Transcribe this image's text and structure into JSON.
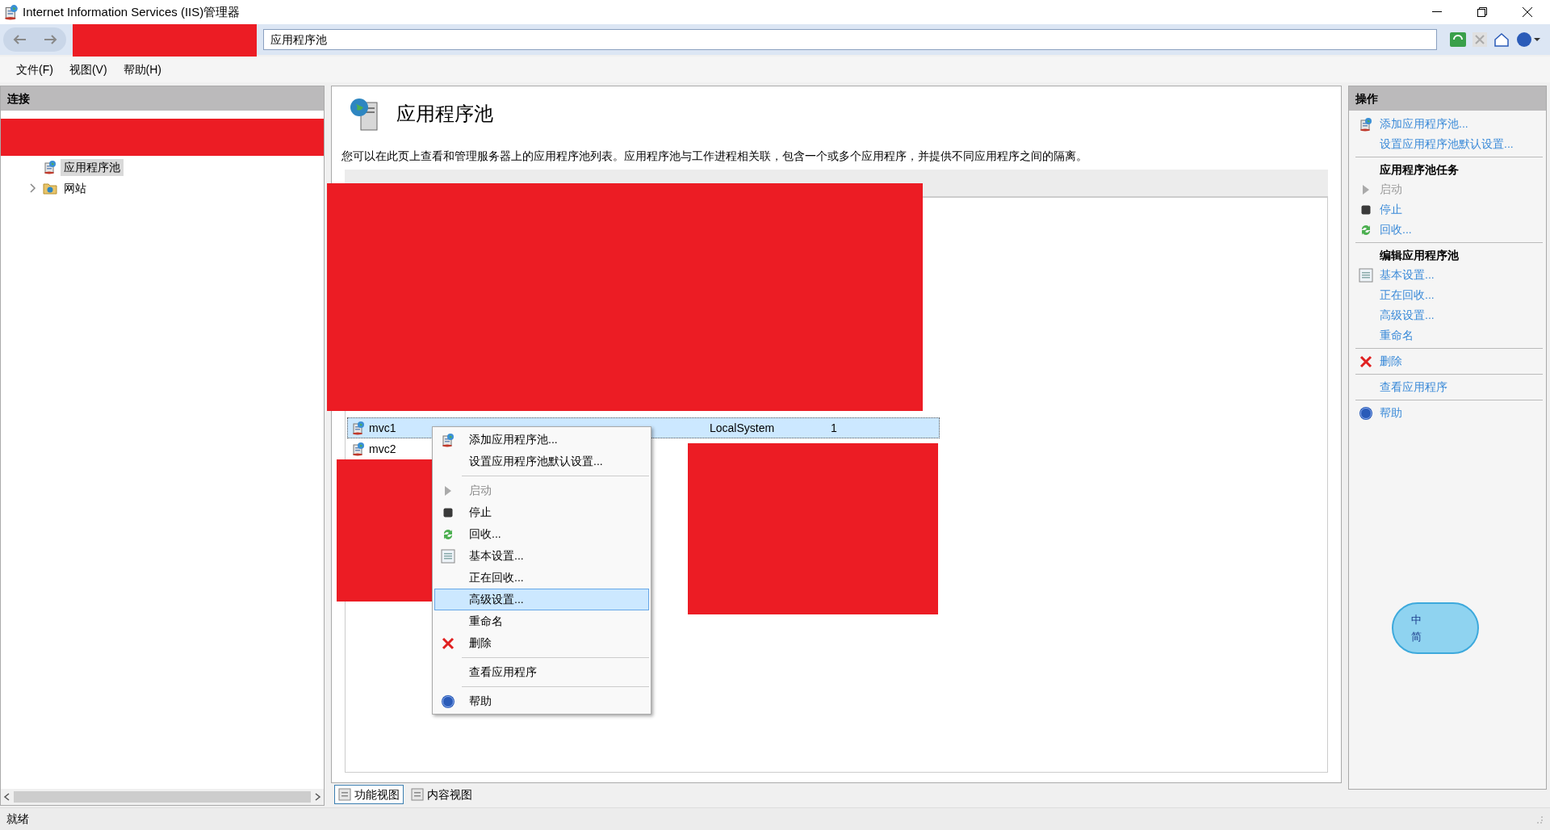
{
  "window": {
    "title": "Internet Information Services (IIS)管理器"
  },
  "address_bar": {
    "breadcrumb": "应用程序池"
  },
  "menu": [
    "文件(F)",
    "视图(V)",
    "帮助(H)"
  ],
  "connections": {
    "title": "连接",
    "tree": [
      {
        "label": "应用程序池",
        "selected": true,
        "expandable": false
      },
      {
        "label": "网站",
        "selected": false,
        "expandable": true
      }
    ]
  },
  "page": {
    "title": "应用程序池",
    "description": "您可以在此页上查看和管理服务器上的应用程序池列表。应用程序池与工作进程相关联，包含一个或多个应用程序，并提供不同应用程序之间的隔离。",
    "rows": [
      {
        "name": "mvc1",
        "selected": true,
        "column_5": "LocalSystem",
        "column_6": "1"
      },
      {
        "name": "mvc2",
        "selected": false
      }
    ]
  },
  "views": [
    {
      "label": "功能视图",
      "selected": true
    },
    {
      "label": "内容视图",
      "selected": false
    }
  ],
  "context_menu": {
    "items": [
      {
        "kind": "item",
        "label": "添加应用程序池...",
        "disabled": false,
        "selected": false
      },
      {
        "kind": "item",
        "label": "设置应用程序池默认设置...",
        "disabled": false,
        "selected": false
      },
      {
        "kind": "separator"
      },
      {
        "kind": "item",
        "label": "启动",
        "disabled": true,
        "selected": false
      },
      {
        "kind": "item",
        "label": "停止",
        "disabled": false,
        "selected": false
      },
      {
        "kind": "item",
        "label": "回收...",
        "disabled": false,
        "selected": false
      },
      {
        "kind": "item",
        "label": "基本设置...",
        "disabled": false,
        "selected": false
      },
      {
        "kind": "item",
        "label": "正在回收...",
        "disabled": false,
        "selected": false
      },
      {
        "kind": "item",
        "label": "高级设置...",
        "disabled": false,
        "selected": true
      },
      {
        "kind": "item",
        "label": "重命名",
        "disabled": false,
        "selected": false
      },
      {
        "kind": "item",
        "label": "删除",
        "disabled": false,
        "selected": false
      },
      {
        "kind": "separator"
      },
      {
        "kind": "item",
        "label": "查看应用程序",
        "disabled": false,
        "selected": false
      },
      {
        "kind": "separator"
      },
      {
        "kind": "item",
        "label": "帮助",
        "disabled": false,
        "selected": false
      }
    ]
  },
  "actions": {
    "title": "操作",
    "items": [
      {
        "kind": "link",
        "label": "添加应用程序池...",
        "disabled": false
      },
      {
        "kind": "link",
        "label": "设置应用程序池默认设置...",
        "disabled": false
      },
      {
        "kind": "separator"
      },
      {
        "kind": "heading",
        "label": "应用程序池任务"
      },
      {
        "kind": "link",
        "label": "启动",
        "disabled": true
      },
      {
        "kind": "link",
        "label": "停止",
        "disabled": false
      },
      {
        "kind": "link",
        "label": "回收...",
        "disabled": false
      },
      {
        "kind": "separator"
      },
      {
        "kind": "heading",
        "label": "编辑应用程序池"
      },
      {
        "kind": "link",
        "label": "基本设置...",
        "disabled": false
      },
      {
        "kind": "link",
        "label": "正在回收...",
        "disabled": false
      },
      {
        "kind": "link",
        "label": "高级设置...",
        "disabled": false
      },
      {
        "kind": "link",
        "label": "重命名",
        "disabled": false
      },
      {
        "kind": "separator"
      },
      {
        "kind": "link",
        "label": "删除",
        "disabled": false
      },
      {
        "kind": "separator"
      },
      {
        "kind": "link",
        "label": "查看应用程序",
        "disabled": false
      },
      {
        "kind": "separator"
      },
      {
        "kind": "link",
        "label": "帮助",
        "disabled": false
      }
    ]
  },
  "status_bar": {
    "text": "就绪"
  },
  "ime_widget": {
    "labels": [
      "中",
      "简"
    ]
  }
}
